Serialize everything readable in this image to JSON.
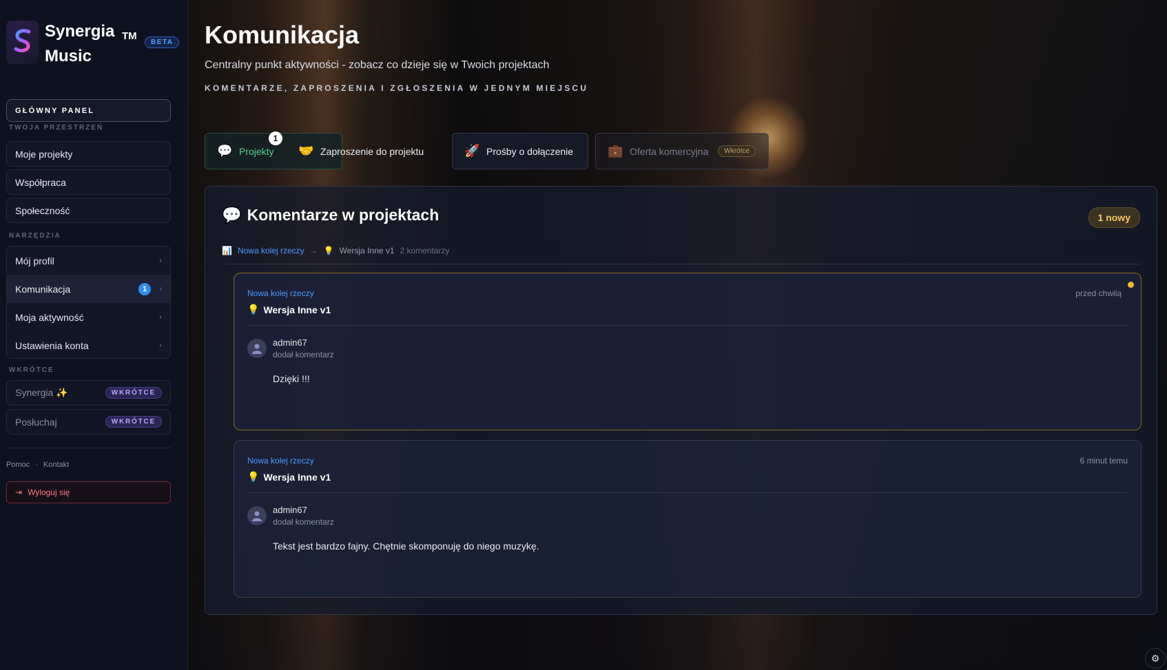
{
  "brand": {
    "name": "Synergia Music",
    "tm": "TM",
    "beta": "BETA",
    "logo_text": "Synergia Music"
  },
  "sidebar": {
    "main_panel": "GŁÓWNY PANEL",
    "workspace_label": "TWOJA PRZESTRZEŃ",
    "workspace_items": [
      {
        "label": "Moje projekty"
      },
      {
        "label": "Współpraca"
      },
      {
        "label": "Społeczność"
      }
    ],
    "tools_label": "NARZĘDZIA",
    "tools_items": [
      {
        "label": "Mój profil",
        "badge": ""
      },
      {
        "label": "Komunikacja",
        "badge": "1"
      },
      {
        "label": "Moja aktywność",
        "badge": ""
      },
      {
        "label": "Ustawienia konta",
        "badge": ""
      }
    ],
    "soon_label": "WKRÓTCE",
    "soon_items": [
      {
        "label": "Synergia ✨",
        "badge": "WKRÓTCE"
      },
      {
        "label": "Posłuchaj",
        "badge": "WKRÓTCE"
      }
    ],
    "footer": {
      "help": "Pomoc",
      "dot": "·",
      "contact": "Kontakt"
    },
    "logout": "Wyloguj się"
  },
  "page": {
    "title": "Komunikacja",
    "subtitle": "Centralny punkt aktywności - zobacz co dzieje się w Twoich projektach",
    "tagline": "KOMENTARZE, ZAPROSZENIA I ZGŁOSZENIA W JEDNYM MIEJSCU"
  },
  "tabs": [
    {
      "label": "Projekty",
      "icon": "💬",
      "badge": "1"
    },
    {
      "label": "Zaproszenie do projektu",
      "icon": "🤝"
    },
    {
      "label": "Prośby o dołączenie",
      "icon": "🚀"
    },
    {
      "label": "Oferta komercyjna",
      "icon": "💼",
      "soon": "Wkrótce"
    }
  ],
  "panel": {
    "icon": "💬",
    "title": "Komentarze w projektach",
    "new_badge": "1 nowy",
    "crumb": {
      "project_icon": "📊",
      "project": "Nowa kolej rzeczy",
      "arrow": "→",
      "version_icon": "💡",
      "version": "Wersja Inne v1",
      "count": "2 komentarzy"
    },
    "comments": [
      {
        "project": "Nowa kolej rzeczy",
        "version_icon": "💡",
        "version": "Wersja Inne v1",
        "time": "przed chwilą",
        "user": "admin67",
        "action": "dodał komentarz",
        "text": "Dzięki !!!",
        "unread": true
      },
      {
        "project": "Nowa kolej rzeczy",
        "version_icon": "💡",
        "version": "Wersja Inne v1",
        "time": "6 minut temu",
        "user": "admin67",
        "action": "dodał komentarz",
        "text": "Tekst jest bardzo fajny. Chętnie skomponuję do niego muzykę.",
        "unread": false
      }
    ]
  },
  "colors": {
    "accent_green": "#4fd18b",
    "link_blue": "#4a9bff",
    "unread_dot": "#f5b730",
    "badge_blue": "#2d8ff0"
  }
}
